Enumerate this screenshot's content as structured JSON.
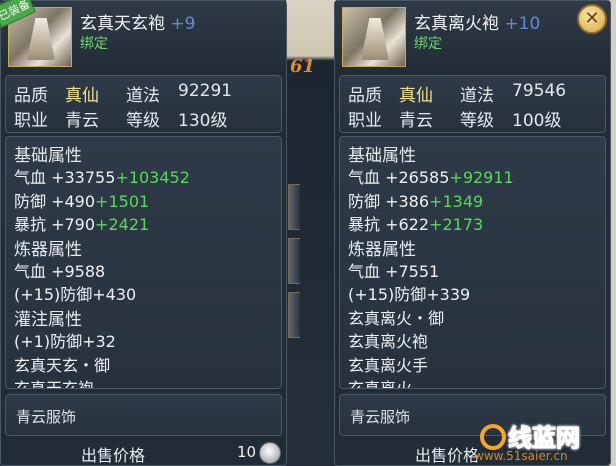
{
  "left_item": {
    "tag": "已装备",
    "name": "玄真天玄袍",
    "plus": "+9",
    "bound": "绑定",
    "quality_label": "品质",
    "quality_value": "真仙",
    "daofa_label": "道法",
    "daofa_value": "92291",
    "career_label": "职业",
    "career_value": "青云",
    "level_label": "等级",
    "level_value": "130级",
    "lines": [
      {
        "text": "基础属性",
        "style": "h"
      },
      {
        "text": "气血 +33755",
        "extra": "+103452"
      },
      {
        "text": "防御 +490",
        "extra": "+1501"
      },
      {
        "text": "暴抗 +790",
        "extra": "+2421"
      },
      {
        "text": "炼器属性",
        "style": "h"
      },
      {
        "text": "气血 +9588"
      },
      {
        "text": "(+15)防御+430",
        "style": "grey"
      },
      {
        "text": "灌注属性",
        "style": "h"
      },
      {
        "text": "(+1)防御+32"
      },
      {
        "text": "玄真天玄・御",
        "style": "green"
      },
      {
        "text": "玄真天玄袍",
        "style": "grey"
      }
    ],
    "type": "青云服饰",
    "price_label": "出售价格",
    "price_value": "10"
  },
  "right_item": {
    "name": "玄真离火袍",
    "plus": "+10",
    "bound": "绑定",
    "quality_label": "品质",
    "quality_value": "真仙",
    "daofa_label": "道法",
    "daofa_value": "79546",
    "career_label": "职业",
    "career_value": "青云",
    "level_label": "等级",
    "level_value": "100级",
    "lines": [
      {
        "text": "基础属性",
        "style": "h"
      },
      {
        "text": "气血 +26585",
        "extra": "+92911"
      },
      {
        "text": "防御 +386",
        "extra": "+1349"
      },
      {
        "text": "暴抗 +622",
        "extra": "+2173"
      },
      {
        "text": "炼器属性",
        "style": "h"
      },
      {
        "text": "气血 +7551"
      },
      {
        "text": "(+15)防御+339",
        "style": "grey"
      },
      {
        "text": "玄真离火・御",
        "style": "green"
      },
      {
        "text": "玄真离火袍",
        "style": "grey"
      },
      {
        "text": "玄真离火手",
        "style": "grey"
      },
      {
        "text": "玄真离火...",
        "style": "grey"
      }
    ],
    "type": "青云服饰",
    "price_label": "出售价格"
  },
  "background_number": "61",
  "watermark": {
    "logo": "线蓝网",
    "url": "www.51saiеr.cn"
  },
  "colors": {
    "bonus": "#55dd55",
    "quality": "#f3e08a",
    "enhance": "#5f8ddc"
  }
}
